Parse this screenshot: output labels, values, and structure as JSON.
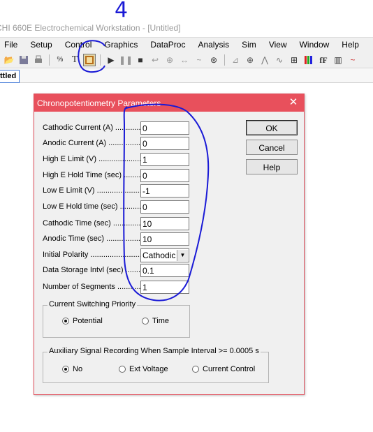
{
  "app": {
    "title": "CHI 660E Electrochemical Workstation - [Untitled]"
  },
  "menu": [
    "File",
    "Setup",
    "Control",
    "Graphics",
    "DataProc",
    "Analysis",
    "Sim",
    "View",
    "Window",
    "Help"
  ],
  "document_tab": "ttled",
  "dialog": {
    "title": "Chronopotentiometry Parameters",
    "close_icon": "close-icon",
    "params": [
      {
        "label": "Cathodic Current (A)",
        "value": "0"
      },
      {
        "label": "Anodic Current (A)",
        "value": "0"
      },
      {
        "label": "High E Limit (V)",
        "value": "1"
      },
      {
        "label": "High E Hold Time (sec)",
        "value": "0"
      },
      {
        "label": "Low E Limit (V)",
        "value": "-1"
      },
      {
        "label": "Low E Hold time (sec)",
        "value": "0"
      },
      {
        "label": "Cathodic Time (sec)",
        "value": "10"
      },
      {
        "label": "Anodic Time (sec)",
        "value": "10"
      },
      {
        "label": "Initial Polarity",
        "value": "Cathodic"
      },
      {
        "label": "Data Storage Intvl (sec)",
        "value": "0.1"
      },
      {
        "label": "Number of Segments",
        "value": "1"
      }
    ],
    "buttons": {
      "ok": "OK",
      "cancel": "Cancel",
      "help": "Help"
    },
    "switching": {
      "title": "Current Switching Priority",
      "options": [
        "Potential",
        "Time"
      ],
      "selected": "Potential"
    },
    "aux": {
      "title": "Auxiliary Signal Recording When Sample Interval >= 0.0005 s",
      "options": [
        "No",
        "Ext Voltage",
        "Current Control"
      ],
      "selected": "No"
    }
  },
  "annotation": {
    "number": "4",
    "color": "#1a1ad6"
  }
}
